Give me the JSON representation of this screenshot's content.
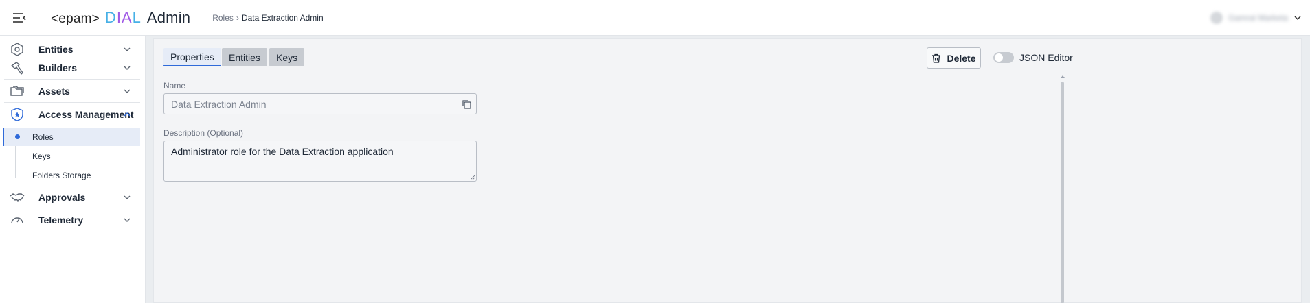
{
  "header": {
    "logo_epam": "<epam>",
    "logo_dial_d": "D",
    "logo_dial_ai": "IA",
    "logo_dial_l": "L",
    "logo_admin": "Admin",
    "breadcrumb": {
      "parent": "Roles",
      "separator": "›",
      "current": "Data Extraction Admin"
    },
    "user_name": "Gamrat Marketa"
  },
  "sidebar": {
    "items": [
      {
        "label": "Entities",
        "icon": "hexagon-icon",
        "expanded": false
      },
      {
        "label": "Builders",
        "icon": "hammer-icon",
        "expanded": false
      },
      {
        "label": "Assets",
        "icon": "folders-icon",
        "expanded": false
      },
      {
        "label": "Access Management",
        "icon": "shield-star-icon",
        "expanded": true
      },
      {
        "label": "Approvals",
        "icon": "handshake-icon",
        "expanded": false
      },
      {
        "label": "Telemetry",
        "icon": "gauge-icon",
        "expanded": false
      }
    ],
    "sub_items": [
      {
        "label": "Roles",
        "active": true
      },
      {
        "label": "Keys",
        "active": false
      },
      {
        "label": "Folders Storage",
        "active": false
      }
    ]
  },
  "main": {
    "tabs": [
      {
        "label": "Properties",
        "active": true
      },
      {
        "label": "Entities",
        "active": false
      },
      {
        "label": "Keys",
        "active": false
      }
    ],
    "name_label": "Name",
    "name_value": "Data Extraction Admin",
    "description_label": "Description (Optional)",
    "description_value": "Administrator role for the Data Extraction application",
    "delete_label": "Delete",
    "json_editor_label": "JSON Editor",
    "json_editor_on": false
  },
  "colors": {
    "accent": "#2f6ad9",
    "dial_blue": "#47b0e6",
    "dial_purple": "#a05ae6"
  }
}
